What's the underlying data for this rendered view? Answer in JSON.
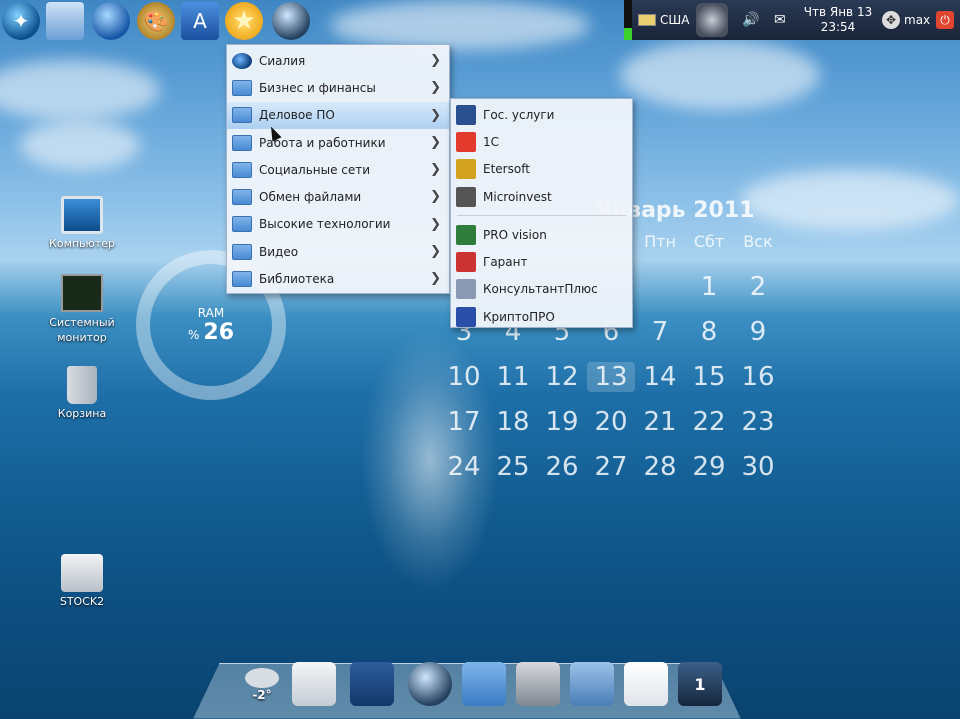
{
  "top_panel": {
    "launchers": [
      {
        "name": "app-launcher-icon"
      },
      {
        "name": "file-manager-icon"
      },
      {
        "name": "browser-globe-icon"
      },
      {
        "name": "graphics-palette-icon"
      },
      {
        "name": "office-tools-icon"
      },
      {
        "name": "favorites-star-icon"
      },
      {
        "name": "media-player-icon"
      }
    ],
    "tray": {
      "keyboard_layout": "США",
      "clock_date": "Чтв Янв 13",
      "clock_time": "23:54",
      "user": "max"
    }
  },
  "category_menu": {
    "items": [
      {
        "label": "Сиалия",
        "icon": "sialia-icon"
      },
      {
        "label": "Бизнес и финансы",
        "icon": "folder-icon"
      },
      {
        "label": "Деловое ПО",
        "icon": "folder-icon",
        "active": true
      },
      {
        "label": "Работа и работники",
        "icon": "folder-icon"
      },
      {
        "label": "Социальные сети",
        "icon": "folder-icon"
      },
      {
        "label": "Обмен файлами",
        "icon": "folder-icon"
      },
      {
        "label": "Высокие технологии",
        "icon": "folder-icon"
      },
      {
        "label": "Видео",
        "icon": "folder-icon"
      },
      {
        "label": "Библиотека",
        "icon": "folder-icon"
      }
    ]
  },
  "submenu": {
    "group1": [
      {
        "label": "Гос. услуги",
        "icon": "gov-services-icon"
      },
      {
        "label": "1С",
        "icon": "1c-icon"
      },
      {
        "label": "Etersoft",
        "icon": "etersoft-icon"
      },
      {
        "label": "Microinvest",
        "icon": "microinvest-icon"
      }
    ],
    "group2": [
      {
        "label": "PRO vision",
        "icon": "pro-vision-icon"
      },
      {
        "label": "Гарант",
        "icon": "garant-icon"
      },
      {
        "label": "КонсультантПлюс",
        "icon": "consultant-plus-icon"
      },
      {
        "label": "КриптоПРО",
        "icon": "cryptopro-icon"
      }
    ]
  },
  "desktop_icons": [
    {
      "label": "Компьютер",
      "icon": "computer-icon"
    },
    {
      "label": "Системный монитор",
      "icon": "system-monitor-icon"
    },
    {
      "label": "Корзина",
      "icon": "trash-icon"
    },
    {
      "label": "STOCK2",
      "icon": "hard-drive-icon"
    }
  ],
  "ram_widget": {
    "label": "RAM",
    "unit": "%",
    "value": "26"
  },
  "calendar": {
    "title": "Январь 2011",
    "weekdays": [
      "Птн",
      "Сбт",
      "Вск"
    ],
    "rows": [
      [
        "",
        "",
        "",
        "",
        "",
        "1",
        "2"
      ],
      [
        "3",
        "4",
        "5",
        "6",
        "7",
        "8",
        "9"
      ],
      [
        "10",
        "11",
        "12",
        "13",
        "14",
        "15",
        "16"
      ],
      [
        "17",
        "18",
        "19",
        "20",
        "21",
        "22",
        "23"
      ],
      [
        "24",
        "25",
        "26",
        "27",
        "28",
        "29",
        "30"
      ]
    ],
    "today": "13"
  },
  "dock": {
    "weather": "-2°",
    "items": [
      {
        "name": "text-editor-icon"
      },
      {
        "name": "image-viewer-icon"
      },
      {
        "name": "media-player-icon"
      },
      {
        "name": "home-folder-icon"
      },
      {
        "name": "video-editor-icon"
      },
      {
        "name": "file-cabinet-icon"
      },
      {
        "name": "whiteboard-icon"
      },
      {
        "name": "workspace-switcher-icon",
        "label": "1"
      }
    ]
  }
}
